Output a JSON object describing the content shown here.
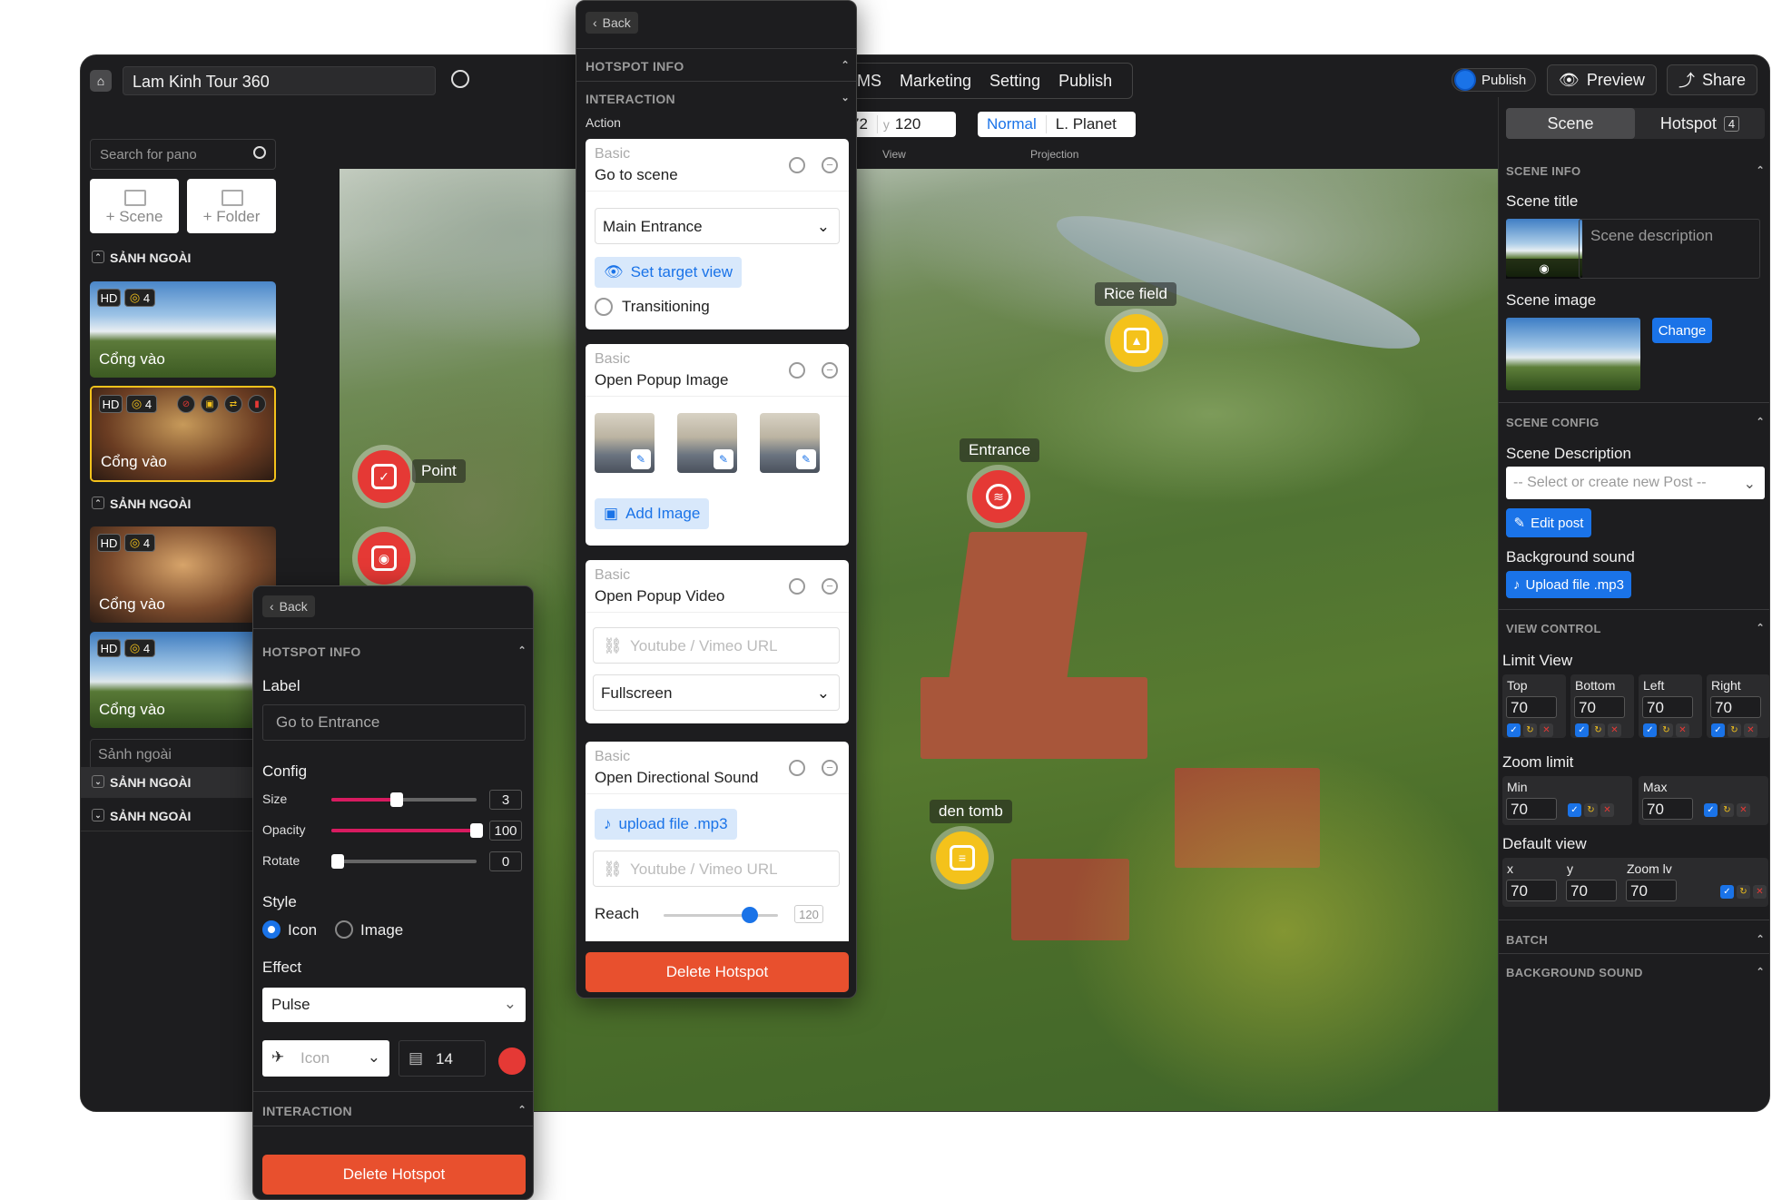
{
  "app": {
    "tour_title": "Lam Kinh Tour 360",
    "menu": [
      "MS",
      "Marketing",
      "Setting",
      "Publish"
    ],
    "publish_toggle_label": "Publish",
    "preview_label": "Preview",
    "share_label": "Share",
    "view": {
      "x": "72",
      "y_label": "y",
      "y": "120",
      "caption": "View"
    },
    "projection": {
      "options": [
        "Normal",
        "L. Planet"
      ],
      "selected": "Normal",
      "caption": "Projection"
    }
  },
  "left_sidebar": {
    "search_placeholder": "Search for pano",
    "add_scene": "+ Scene",
    "add_folder": "+ Folder",
    "groups": [
      {
        "label": "SẢNH NGOÀI"
      },
      {
        "label": "SẢNH NGOÀI"
      },
      {
        "label": "SẢNH NGOÀI"
      },
      {
        "label": "SẢNH NGOÀI"
      }
    ],
    "scenes": [
      {
        "hd": "HD",
        "count": "4",
        "caption": "Cổng vào"
      },
      {
        "hd": "HD",
        "count": "4",
        "caption": "Cổng vào"
      },
      {
        "hd": "HD",
        "count": "4",
        "caption": "Cổng vào"
      },
      {
        "hd": "HD",
        "count": "4",
        "caption": "Cổng vào"
      }
    ],
    "subfolder_input": "Sảnh ngoài"
  },
  "panorama": {
    "hotspots": [
      {
        "label": "Point",
        "color": "#e53935"
      },
      {
        "label": "Rice field",
        "color": "#f4c21b"
      },
      {
        "label": "Entrance",
        "color": "#e53935"
      },
      {
        "label": "den tomb",
        "color": "#f4c21b"
      }
    ]
  },
  "hotspot_panel_left": {
    "back": "Back",
    "hotspot_info": "HOTSPOT INFO",
    "label_title": "Label",
    "label_value": "Go to Entrance",
    "config_title": "Config",
    "size_label": "Size",
    "size_value": "3",
    "size_pct": 0.45,
    "opacity_label": "Opacity",
    "opacity_value": "100",
    "opacity_pct": 1.0,
    "rotate_label": "Rotate",
    "rotate_value": "0",
    "rotate_pct": 0.0,
    "style_title": "Style",
    "style_options": [
      "Icon",
      "Image"
    ],
    "effect_title": "Effect",
    "effect_value": "Pulse",
    "icon_select": "Icon",
    "icon_size": "14",
    "icon_color": "#e53935",
    "interaction": "INTERACTION",
    "delete": "Delete Hotspot"
  },
  "hotspot_panel_mid": {
    "back": "Back",
    "hotspot_info": "HOTSPOT INFO",
    "interaction": "INTERACTION",
    "action_label": "Action",
    "cards": {
      "goto": {
        "basic": "Basic",
        "title": "Go to scene",
        "scene": "Main Entrance",
        "set_view": "Set target view",
        "transitioning": "Transitioning"
      },
      "popup_image": {
        "basic": "Basic",
        "title": "Open Popup Image",
        "add_image": "Add Image"
      },
      "popup_video": {
        "basic": "Basic",
        "title": "Open Popup Video",
        "url_placeholder": "Youtube / Vimeo URL",
        "mode": "Fullscreen"
      },
      "sound": {
        "basic": "Basic",
        "title": "Open Directional Sound",
        "upload": "upload file .mp3",
        "url_placeholder": "Youtube / Vimeo URL",
        "reach_label": "Reach",
        "reach_value": "120",
        "reach_pct": 0.75
      }
    },
    "delete": "Delete Hotspot"
  },
  "right_panel": {
    "tabs": {
      "scene": "Scene",
      "hotspot": "Hotspot",
      "hotspot_count": "4"
    },
    "scene_info": "SCENE INFO",
    "scene_title_label": "Scene title",
    "scene_description_placeholder": "Scene description",
    "scene_image_label": "Scene image",
    "change": "Change",
    "scene_config": "SCENE CONFIG",
    "scene_description_label": "Scene Description",
    "post_select_placeholder": "-- Select or create new Post --",
    "edit_post": "Edit post",
    "background_sound_label": "Background sound",
    "upload_mp3": "Upload file .mp3",
    "view_control": "VIEW CONTROL",
    "limit_view_label": "Limit View",
    "limit_view": [
      {
        "label": "Top",
        "value": "70"
      },
      {
        "label": "Bottom",
        "value": "70"
      },
      {
        "label": "Left",
        "value": "70"
      },
      {
        "label": "Right",
        "value": "70"
      }
    ],
    "zoom_limit_label": "Zoom limit",
    "zoom_limit": [
      {
        "label": "Min",
        "value": "70"
      },
      {
        "label": "Max",
        "value": "70"
      }
    ],
    "default_view_label": "Default view",
    "default_view": [
      {
        "label": "x",
        "value": "70"
      },
      {
        "label": "y",
        "value": "70"
      },
      {
        "label": "Zoom lv",
        "value": "70"
      }
    ],
    "batch": "BATCH",
    "background_sound": "BACKGROUND SOUND"
  }
}
